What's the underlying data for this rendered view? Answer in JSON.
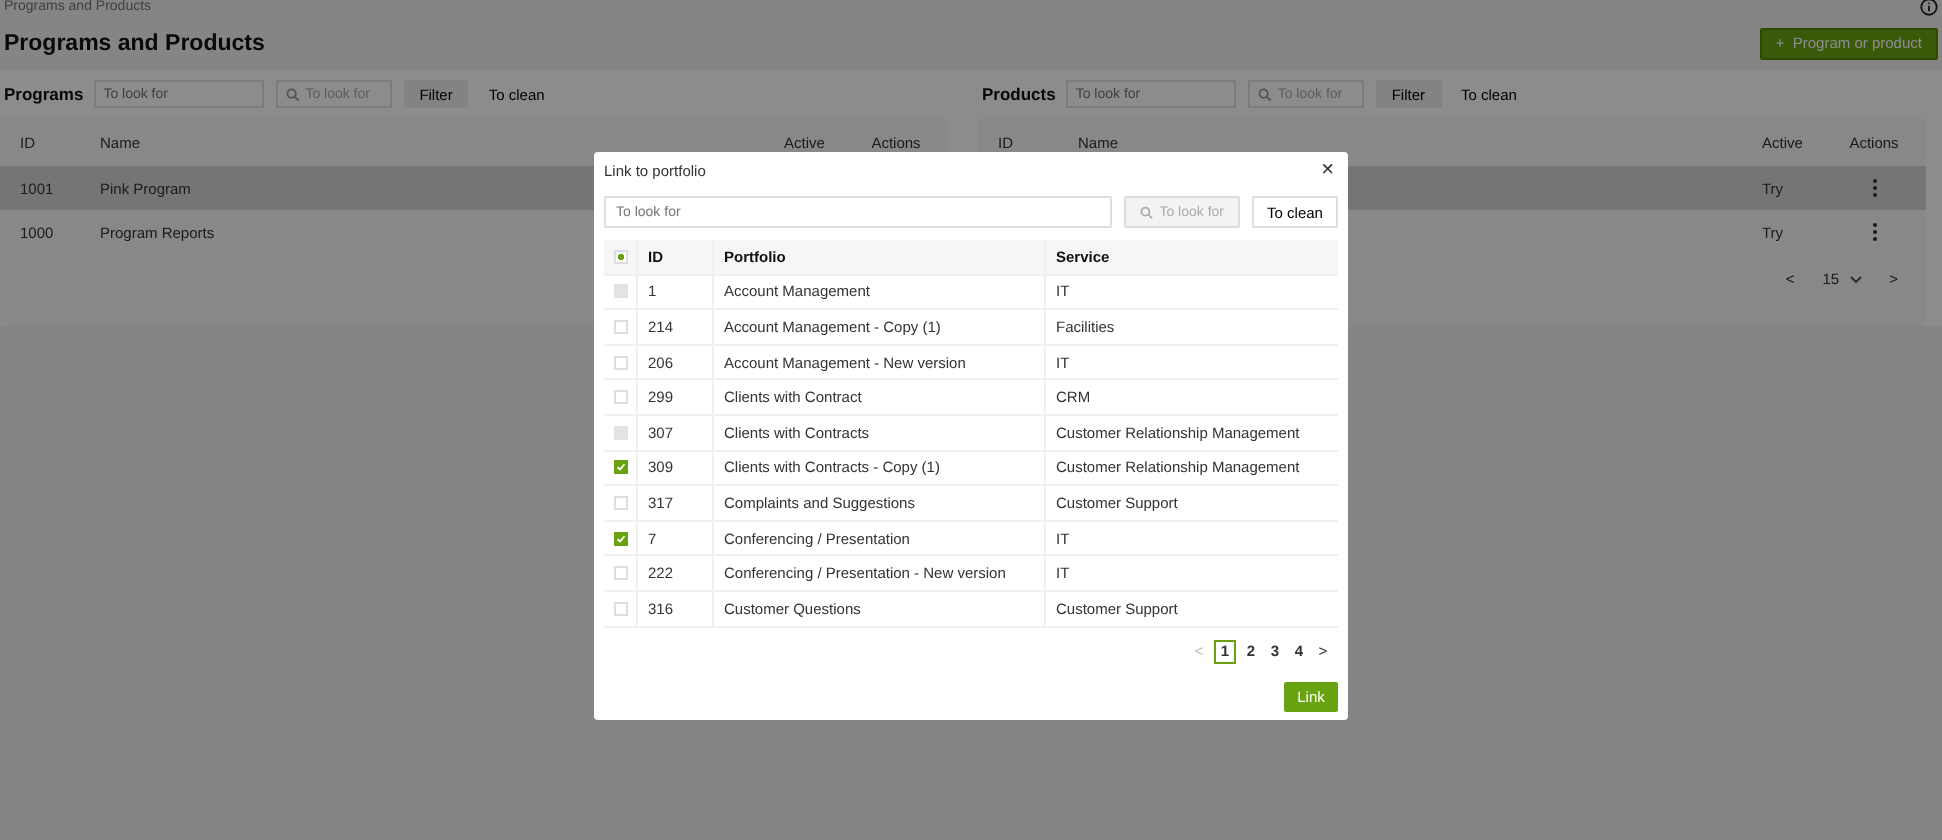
{
  "breadcrumb": "Programs and Products",
  "title": "Programs and Products",
  "add_button": {
    "icon": "+",
    "label": "Program or product"
  },
  "panels": [
    {
      "label": "Programs",
      "search": {
        "placeholder": "To look for"
      },
      "search_button": {
        "placeholder": "To look for"
      },
      "filter": "Filter",
      "clean": "To clean",
      "columns": [
        "ID",
        "Name",
        "Active",
        "Actions"
      ],
      "rows": [
        {
          "id": "1001",
          "name": "Pink Program",
          "selected": true
        },
        {
          "id": "1000",
          "name": "Program Reports",
          "selected": false
        }
      ]
    },
    {
      "label": "Products",
      "search": {
        "placeholder": "To look for"
      },
      "search_button": {
        "placeholder": "To look for"
      },
      "filter": "Filter",
      "clean": "To clean",
      "columns": [
        "ID",
        "Name",
        "Active",
        "Actions"
      ],
      "rows": [
        {
          "active": "Try",
          "selected": true
        },
        {
          "active": "Try",
          "selected": false
        }
      ],
      "pager": {
        "prev": "<",
        "per_page": "15",
        "next": ">"
      }
    }
  ],
  "dialog": {
    "title": "Link to portfolio",
    "close": "×",
    "search": {
      "placeholder": "To look for"
    },
    "search_button": {
      "label": "To look for",
      "disabled": true
    },
    "clean": "To clean",
    "header_checkbox": {
      "indeterminate": true
    },
    "columns": [
      "ID",
      "Portfolio",
      "Service"
    ],
    "rows": [
      {
        "id": "1",
        "portfolio": "Account Management",
        "service": "IT",
        "checked": false,
        "disabled": true
      },
      {
        "id": "214",
        "portfolio": "Account Management - Copy (1)",
        "service": "Facilities",
        "checked": false,
        "disabled": false
      },
      {
        "id": "206",
        "portfolio": "Account Management - New version",
        "service": "IT",
        "checked": false,
        "disabled": false
      },
      {
        "id": "299",
        "portfolio": "Clients with Contract",
        "service": "CRM",
        "checked": false,
        "disabled": false
      },
      {
        "id": "307",
        "portfolio": "Clients with Contracts",
        "service": "Customer Relationship Management",
        "checked": false,
        "disabled": true
      },
      {
        "id": "309",
        "portfolio": "Clients with Contracts - Copy (1)",
        "service": "Customer Relationship Management",
        "checked": true,
        "disabled": false
      },
      {
        "id": "317",
        "portfolio": "Complaints and Suggestions",
        "service": "Customer Support",
        "checked": false,
        "disabled": false
      },
      {
        "id": "7",
        "portfolio": "Conferencing / Presentation",
        "service": "IT",
        "checked": true,
        "disabled": false
      },
      {
        "id": "222",
        "portfolio": "Conferencing / Presentation - New version",
        "service": "IT",
        "checked": false,
        "disabled": false
      },
      {
        "id": "316",
        "portfolio": "Customer Questions",
        "service": "Customer Support",
        "checked": false,
        "disabled": false
      }
    ],
    "pagination": {
      "prev": "<",
      "next": ">",
      "pages": [
        {
          "label": "1",
          "selected": true
        },
        {
          "label": "2",
          "selected": false
        },
        {
          "label": "3",
          "selected": false
        },
        {
          "label": "4",
          "selected": false
        }
      ]
    },
    "link_button": "Link"
  }
}
